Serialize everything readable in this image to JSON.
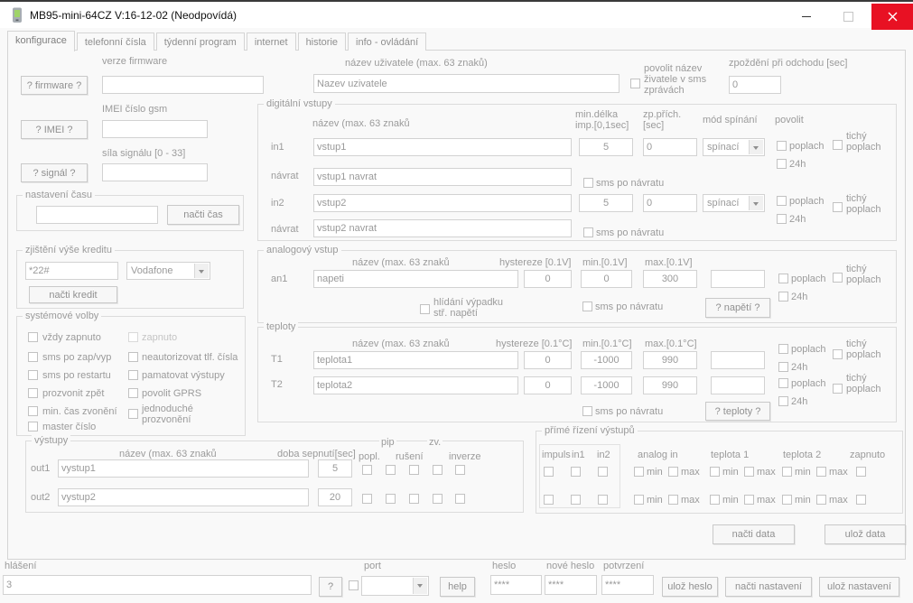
{
  "window": {
    "title": "MB95-mini-64CZ V:16-12-02 (Neodpovídá)"
  },
  "colors": {
    "titlebar_close": "#e81123",
    "phone_icon_screen": "#9fd468"
  },
  "tabs": [
    "konfigurace",
    "telefonní čísla",
    "týdenní program",
    "internet",
    "historie",
    "info - ovládání"
  ],
  "firmware": {
    "button": "? firmware ?",
    "label": "verze firmware",
    "value": ""
  },
  "imei": {
    "button": "? IMEI ?",
    "label": "IMEI číslo gsm",
    "value": ""
  },
  "signal": {
    "button": "? signál ?",
    "label": "síla signálu [0 - 33]",
    "value": ""
  },
  "time_group": {
    "title": "nastavení času",
    "value": "",
    "load_button": "načti čas"
  },
  "credit_group": {
    "title": "zjištění výše kreditu",
    "code": "*22#",
    "operator": "Vodafone",
    "load_button": "načti kredit"
  },
  "system_group": {
    "title": "systémové volby",
    "left": [
      "vždy zapnuto",
      "sms po zap/vyp",
      "sms po restartu",
      "prozvonit zpět",
      "min. čas zvonění",
      "master číslo"
    ],
    "right": [
      "zapnuto",
      "neautorizovat tlf. čísla",
      "pamatovat výstupy",
      "povolit GPRS",
      "jednoduché prozvonění"
    ]
  },
  "topbar": {
    "user_name_label": "název uživatele (max. 63 znaků)",
    "user_name_value": "Nazev uzivatele",
    "enable_name_cb": "povolit název živatele v sms zprávách",
    "delay_label": "zpoždění při odchodu [sec]",
    "delay_value": "0"
  },
  "digital_group": {
    "title": "digitální vstupy",
    "col_name": "název (max.  63 znaků",
    "col_minlen_1": "min.délka",
    "col_minlen_2": "imp.[0,1sec]",
    "col_delay_1": "zp.přích.",
    "col_delay_2": "[sec]",
    "col_mode": "mód spínání",
    "col_enable": "povolit",
    "rows": [
      {
        "label": "in1",
        "name": "vstup1",
        "minlen": "5",
        "delay": "0",
        "mode": "spínací"
      },
      {
        "label": "návrat",
        "name": "vstup1 navrat"
      },
      {
        "label": "in2",
        "name": "vstup2",
        "minlen": "5",
        "delay": "0",
        "mode": "spínací"
      },
      {
        "label": "návrat",
        "name": "vstup2 navrat"
      }
    ]
  },
  "analog_group": {
    "title": "analogový vstup",
    "col_name": "název (max.  63 znaků",
    "col_hyst": "hystereze [0.1V]",
    "col_min": "min.[0.1V]",
    "col_max": "max.[0.1V]",
    "row": {
      "label": "an1",
      "name": "napeti",
      "hyst": "0",
      "min": "0",
      "max": "300",
      "extra": ""
    },
    "fail_cb": "hlídání výpadku stř. napětí",
    "voltage_button": "? napětí ?"
  },
  "temp_group": {
    "title": "teploty",
    "col_name": "název (max.  63 znaků",
    "col_hyst": "hystereze [0.1°C]",
    "col_min": "min.[0.1°C]",
    "col_max": "max.[0.1°C]",
    "rows": [
      {
        "label": "T1",
        "name": "teplota1",
        "hyst": "0",
        "min": "-1000",
        "max": "990"
      },
      {
        "label": "T2",
        "name": "teplota2",
        "hyst": "0",
        "min": "-1000",
        "max": "990"
      }
    ],
    "temp_button": "? teploty ?"
  },
  "outputs_group": {
    "title": "výstupy",
    "col_name": "název (max.  63 znaků",
    "col_time": "doba sepnutí[sec]",
    "col_popl": "popl.",
    "col_pip": "pip",
    "col_ruseni": "rušení",
    "col_zv": "zv.",
    "col_inverze": "inverze",
    "rows": [
      {
        "label": "out1",
        "name": "vystup1",
        "time": "5"
      },
      {
        "label": "out2",
        "name": "vystup2",
        "time": "20"
      }
    ]
  },
  "direct_group": {
    "title": "přímé řízení výstupů",
    "col_impuls": "impuls",
    "col_in1": "in1",
    "col_in2": "in2",
    "col_analog": "analog in",
    "col_t1": "teplota 1",
    "col_t2": "teplota 2",
    "col_zapnuto": "zapnuto"
  },
  "labels": {
    "poplach": "poplach",
    "tichy": "tichý poplach",
    "h24": "24h",
    "sms_po_navratu": "sms po návratu",
    "min": "min",
    "max": "max"
  },
  "actions": {
    "load_data": "načti data",
    "save_data": "ulož data",
    "save_password": "ulož heslo",
    "load_settings": "načti nastavení",
    "save_settings": "ulož nastavení",
    "help": "help",
    "question": "?"
  },
  "bottom": {
    "hlaseni_label": "hlášení",
    "hlaseni_value": "3",
    "port_label": "port",
    "port_value": "",
    "heslo_label": "heslo",
    "heslo_value": "****",
    "nove_heslo_label": "nové heslo",
    "nove_heslo_value": "****",
    "potvrzeni_label": "potvrzení",
    "potvrzeni_value": "****"
  }
}
